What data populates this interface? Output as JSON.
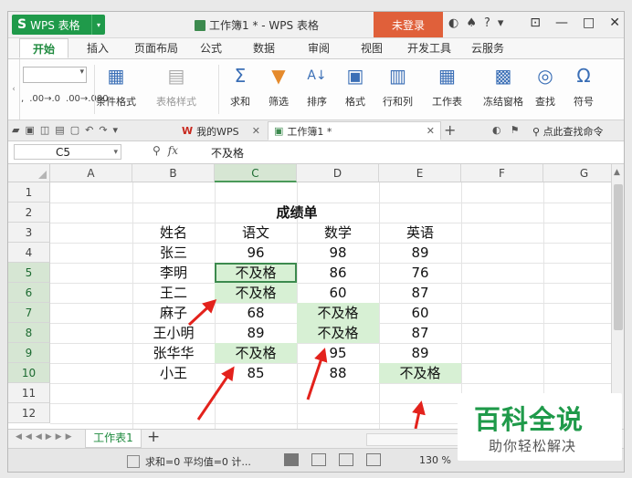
{
  "app": {
    "logo": "S",
    "name": "WPS 表格",
    "menu_arrow": "▾"
  },
  "window": {
    "title": "工作簿1 * - WPS 表格",
    "login": "未登录",
    "minimize": "—",
    "maximize": "□",
    "close": "✕"
  },
  "menu": {
    "tabs": [
      "开始",
      "插入",
      "页面布局",
      "公式",
      "数据",
      "审阅",
      "视图",
      "开发工具",
      "云服务"
    ],
    "active": "开始"
  },
  "ribbon": {
    "number_format": [
      ".00→.0",
      ".00→.000"
    ],
    "buttons": [
      {
        "label": "条件格式",
        "icon": "conditional-format-icon"
      },
      {
        "label": "表格样式",
        "icon": "table-style-icon"
      },
      {
        "label": "求和",
        "icon": "sum-icon"
      },
      {
        "label": "筛选",
        "icon": "filter-icon"
      },
      {
        "label": "排序",
        "icon": "sort-icon"
      },
      {
        "label": "格式",
        "icon": "format-icon"
      },
      {
        "label": "行和列",
        "icon": "rows-cols-icon"
      },
      {
        "label": "工作表",
        "icon": "worksheet-icon"
      },
      {
        "label": "冻结窗格",
        "icon": "freeze-panes-icon"
      },
      {
        "label": "查找",
        "icon": "find-icon"
      },
      {
        "label": "符号",
        "icon": "symbol-icon"
      }
    ]
  },
  "tabs": {
    "wps_tab": "我的WPS",
    "workbook_tab": "工作簿1 *",
    "search_command": "点此查找命令"
  },
  "formula_bar": {
    "name_box": "C5",
    "fx": "fx",
    "value": "不及格"
  },
  "grid": {
    "columns": [
      "A",
      "B",
      "C",
      "D",
      "E",
      "F",
      "G"
    ],
    "rows": [
      "1",
      "2",
      "3",
      "4",
      "5",
      "6",
      "7",
      "8",
      "9",
      "10",
      "11",
      "12"
    ],
    "selected_column": "C",
    "selected_rows": [
      "5",
      "6",
      "7",
      "8",
      "9",
      "10"
    ],
    "title": "成绩单",
    "headers": [
      "姓名",
      "语文",
      "数学",
      "英语"
    ],
    "records": [
      {
        "name": "张三",
        "chinese": "96",
        "math": "98",
        "english": "89"
      },
      {
        "name": "李明",
        "chinese": "不及格",
        "math": "86",
        "english": "76"
      },
      {
        "name": "王二",
        "chinese": "不及格",
        "math": "60",
        "english": "87"
      },
      {
        "name": "麻子",
        "chinese": "68",
        "math": "不及格",
        "english": "60"
      },
      {
        "name": "王小明",
        "chinese": "89",
        "math": "不及格",
        "english": "87"
      },
      {
        "name": "张华华",
        "chinese": "不及格",
        "math": "95",
        "english": "89"
      },
      {
        "name": "小王",
        "chinese": "85",
        "math": "88",
        "english": "不及格"
      }
    ],
    "highlight_color": "#d7f0d4",
    "arrow_color": "#e3221c"
  },
  "sheets": {
    "tabs": [
      "工作表1"
    ],
    "add": "+"
  },
  "status": {
    "text": "求和=0  平均值=0  计...",
    "zoom": "130 %"
  },
  "watermark": {
    "title": "百科全说",
    "subtitle": "助你轻松解决"
  }
}
